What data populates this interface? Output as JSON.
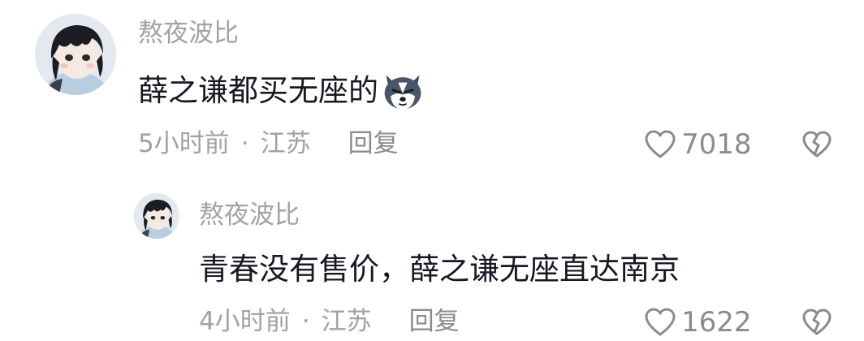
{
  "comments": [
    {
      "username": "熬夜波比",
      "text": "薛之谦都买无座的",
      "emoji_icon": "husky-dog-emoji-icon",
      "time": "5小时前",
      "separator": "·",
      "location": "江苏",
      "reply_label": "回复",
      "likes": "7018"
    }
  ],
  "replies": [
    {
      "username": "熬夜波比",
      "text": "青春没有售价，薛之谦无座直达南京",
      "time": "4小时前",
      "separator": "·",
      "location": "江苏",
      "reply_label": "回复",
      "likes": "1622"
    }
  ],
  "icons": {
    "like": "heart-outline-icon",
    "dislike": "broken-heart-icon"
  },
  "colors": {
    "text_primary": "#161823",
    "text_secondary": "#a1a1a6",
    "icon": "#8a8a90"
  }
}
